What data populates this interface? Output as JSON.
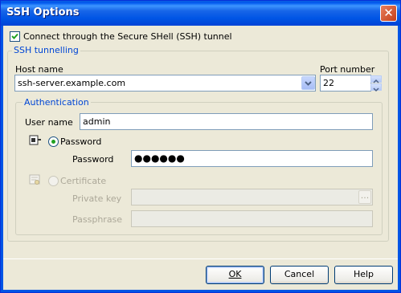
{
  "window": {
    "title": "SSH Options",
    "close_glyph": "✕"
  },
  "ssh_checkbox": {
    "label": "Connect through the Secure SHell (SSH) tunnel",
    "checked": true
  },
  "tunnel_group": {
    "label": "SSH tunnelling",
    "host_label": "Host name",
    "host_value": "ssh-server.example.com",
    "port_label": "Port number",
    "port_value": "22"
  },
  "auth_group": {
    "label": "Authentication",
    "username_label": "User name",
    "username_value": "admin",
    "password_radio_label": "Password",
    "password_field_label": "Password",
    "password_value": "●●●●●●",
    "certificate_radio_label": "Certificate",
    "private_key_label": "Private key",
    "private_key_value": "",
    "browse_glyph": "...",
    "passphrase_label": "Passphrase",
    "passphrase_value": ""
  },
  "buttons": {
    "ok": "OK",
    "cancel": "Cancel",
    "help": "Help"
  }
}
